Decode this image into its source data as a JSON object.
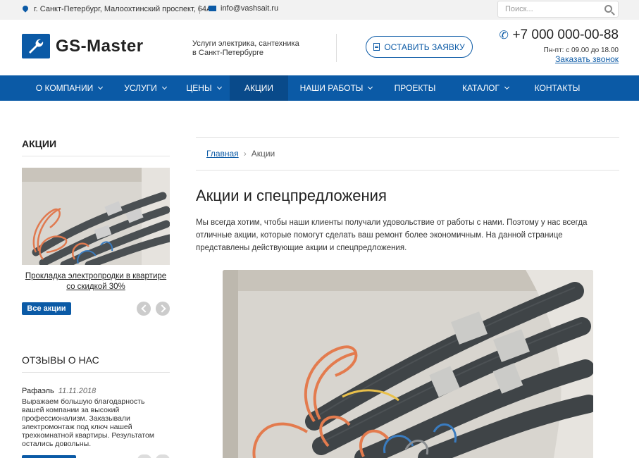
{
  "topbar": {
    "address": "г. Санкт-Петербург, Малоохтинский проспект, 64А",
    "email": "info@vashsait.ru",
    "search_placeholder": "Поиск..."
  },
  "header": {
    "logo_name": "GS-Master",
    "slogan_line1": "Услуги электрика, сантехника",
    "slogan_line2": "в Санкт-Петербурге",
    "order_button": "ОСТАВИТЬ ЗАЯВКУ",
    "phone": "+7 000 000-00-88",
    "hours": "Пн-пт: с 09.00 до 18.00",
    "callback": "Заказать звонок"
  },
  "nav": {
    "items": [
      {
        "label": "О компании"
      },
      {
        "label": "Услуги"
      },
      {
        "label": "Цены"
      },
      {
        "label": "Акции"
      },
      {
        "label": "Наши работы"
      },
      {
        "label": "Проекты"
      },
      {
        "label": "Каталог"
      },
      {
        "label": "Контакты"
      }
    ]
  },
  "sidebar": {
    "promo_title": "АКЦИИ",
    "promo_caption": "Прокладка электропродки в квартире со скидкой 30%",
    "all_button": "Все акции",
    "reviews_title": "ОТЗЫВЫ О НАС",
    "review_author": "Рафаэль",
    "review_date": "11.11.2018",
    "review_text": "Выражаем большую благодарность вашей компании за высокий профессионализм. Заказывали электромонтаж под ключ нашей трехкомнатной квартиры. Результатом остались довольны."
  },
  "main": {
    "breadcrumb_home": "Главная",
    "breadcrumb_sep": "›",
    "breadcrumb_current": "Акции",
    "title": "Акции и спецпредложения",
    "lead": "Мы всегда хотим, чтобы наши клиенты получали удовольствие от работы с нами. Поэтому у нас всегда отличные акции, которые помогут сделать ваш ремонт более экономичным. На данной странице представлены действующие акции и спецпредложения."
  },
  "colors": {
    "brand": "#0b5aa6",
    "nav_active": "#094a8a",
    "topbar_bg": "#f2f2f2"
  },
  "icons": {
    "address": "map-pin-icon",
    "email": "envelope-icon",
    "search": "search-icon",
    "logo": "wrench-icon",
    "order": "document-icon",
    "phone": "phone-icon",
    "nav_dropdown": "chevron-down-icon",
    "slider_prev": "arrow-left-icon",
    "slider_next": "arrow-right-icon"
  }
}
